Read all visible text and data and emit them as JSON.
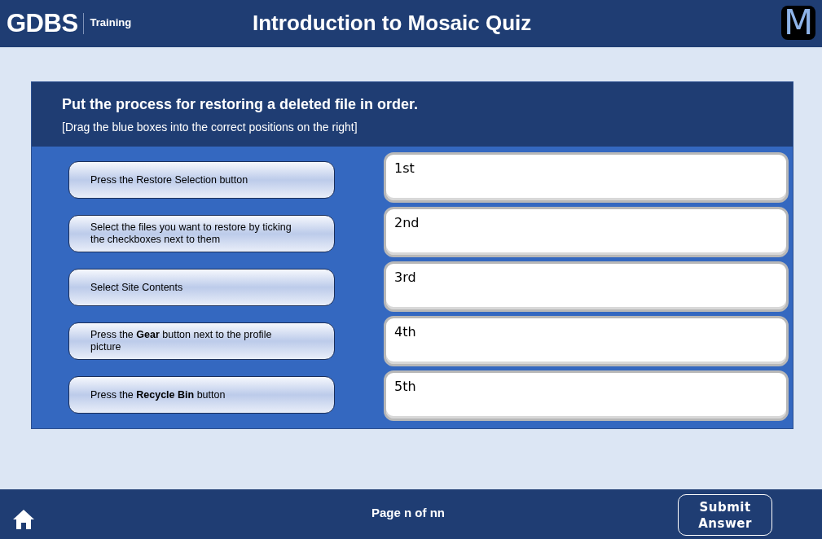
{
  "header": {
    "brand": "GDBS",
    "brand_sub": "Training",
    "title": "Introduction to Mosaic Quiz",
    "logo_letter": "M"
  },
  "question": {
    "prompt": "Put the process for restoring a deleted file in order.",
    "instruction": "[Drag the blue boxes into the correct positions on the right]"
  },
  "drag_items": [
    {
      "text": "Press the Restore Selection button"
    },
    {
      "text": "Select the files you want to restore by ticking the checkboxes next to them"
    },
    {
      "text": "Select Site Contents"
    },
    {
      "text": "Press the **Gear** button next to the profile picture"
    },
    {
      "text": "Press the **Recycle Bin** button"
    }
  ],
  "drop_slots": [
    {
      "label": "1st"
    },
    {
      "label": "2nd"
    },
    {
      "label": "3rd"
    },
    {
      "label": "4th"
    },
    {
      "label": "5th"
    }
  ],
  "footer": {
    "page": "Page n of nn",
    "submit": "Submit Answer"
  }
}
